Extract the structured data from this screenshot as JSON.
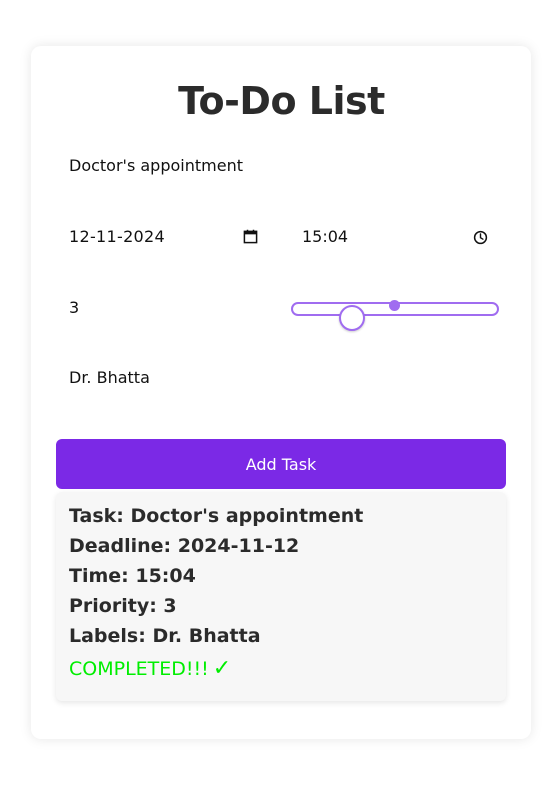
{
  "app": {
    "title": "To-Do List"
  },
  "form": {
    "task_value": "Doctor's appointment",
    "date_value": "12-11-2024",
    "time_value": "15:04",
    "priority_value": "3",
    "priority_slider_fraction": 0.3,
    "labels_value": "Dr. Bhatta",
    "add_button_label": "Add Task",
    "calendar_icon": "calendar-icon",
    "clock_icon": "clock-icon"
  },
  "task": {
    "task_line": "Task: Doctor's appointment",
    "deadline_line": "Deadline: 2024-11-12",
    "time_line": "Time: 15:04",
    "priority_line": "Priority: 3",
    "labels_line": "Labels: Dr. Bhatta",
    "status_text": "COMPLETED!!!",
    "status_icon": "✓"
  },
  "colors": {
    "accent": "#7b29e6",
    "slider": "#a06cf0",
    "completed": "#00ee00",
    "title": "#2b2b2b"
  }
}
